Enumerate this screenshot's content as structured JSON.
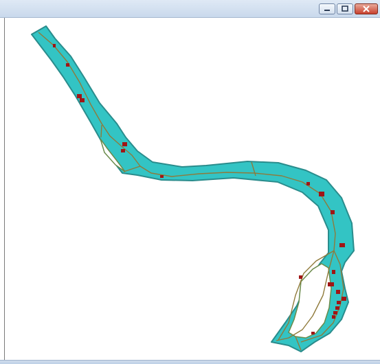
{
  "window": {
    "controls": [
      "minimize-icon",
      "restore-icon",
      "close-icon"
    ]
  },
  "map": {
    "river_fill": "#33c4c4",
    "river_outline": "#2a8c8c",
    "centerline_color": "#8f7a3a",
    "feature_color": "#a01515",
    "island_color": "#ffffff",
    "island_outline": "#6a8a4a"
  }
}
